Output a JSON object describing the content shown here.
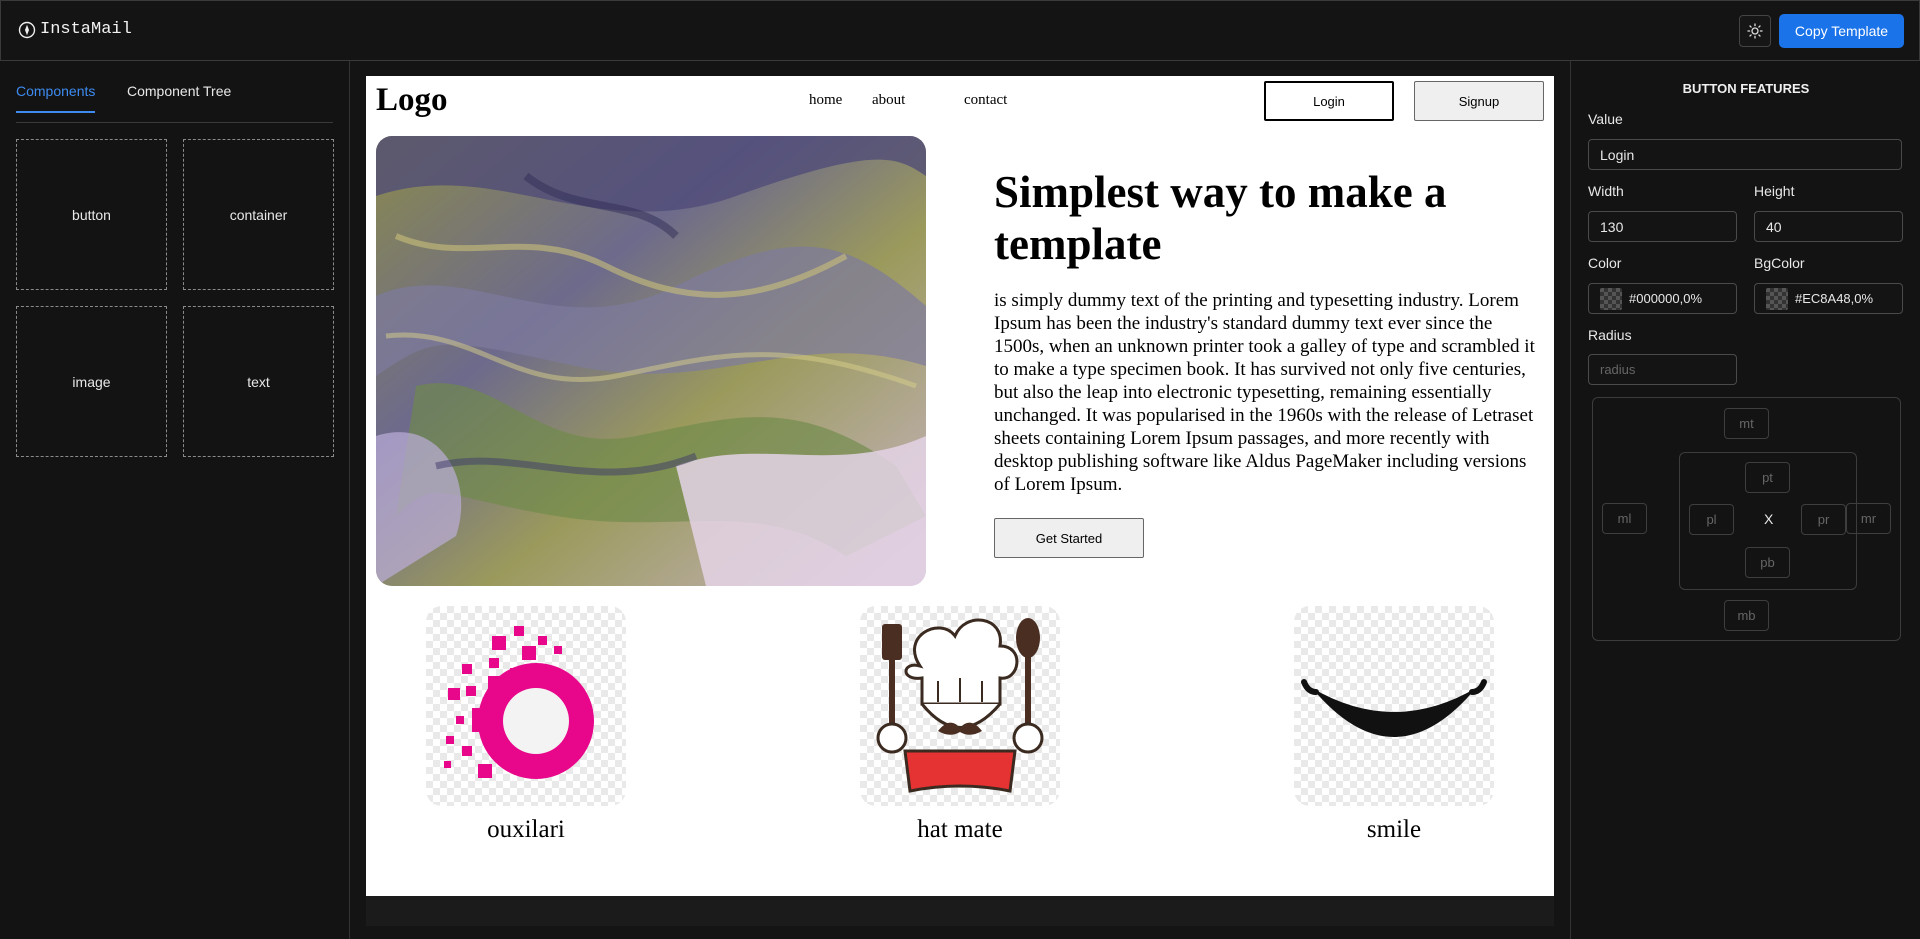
{
  "app": {
    "name": "InstaMail",
    "copy_label": "Copy Template",
    "theme_icon": "sun-icon",
    "brand_icon": "compass-icon"
  },
  "left": {
    "tabs": [
      {
        "label": "Components"
      },
      {
        "label": "Component Tree"
      }
    ],
    "components": [
      {
        "label": "button"
      },
      {
        "label": "container"
      },
      {
        "label": "image"
      },
      {
        "label": "text"
      }
    ]
  },
  "template": {
    "logo": "Logo",
    "nav": [
      {
        "label": "home"
      },
      {
        "label": "about"
      },
      {
        "label": "contact"
      }
    ],
    "login": "Login",
    "signup": "Signup",
    "hero_title": "Simplest way to make a template",
    "hero_body": "is simply dummy text of the printing and typesetting industry. Lorem Ipsum has been the industry's standard dummy text ever since the 1500s, when an unknown printer took a galley of type and scrambled it to make a type specimen book. It has survived not only five centuries, but also the leap into electronic typesetting, remaining essentially unchanged. It was popularised in the 1960s with the release of Letraset sheets containing Lorem Ipsum passages, and more recently with desktop publishing software like Aldus PageMaker including versions of Lorem Ipsum.",
    "cta": "Get Started",
    "cards": [
      {
        "caption": "ouxilari"
      },
      {
        "caption": "hat mate"
      },
      {
        "caption": "smile"
      }
    ]
  },
  "panel": {
    "title": "BUTTON FEATURES",
    "value_label": "Value",
    "value": "Login",
    "width_label": "Width",
    "width": "130",
    "height_label": "Height",
    "height": "40",
    "color_label": "Color",
    "color": "#000000,0%",
    "bgcolor_label": "BgColor",
    "bgcolor": "#EC8A48,0%",
    "radius_label": "Radius",
    "radius_placeholder": "radius",
    "spacing": {
      "mt": "mt",
      "mb": "mb",
      "ml": "ml",
      "mr": "mr",
      "pt": "pt",
      "pb": "pb",
      "pl": "pl",
      "pr": "pr",
      "center": "X"
    }
  },
  "colors": {
    "accent": "#1a73e8",
    "tab_active": "#3d8bf0",
    "ouxilari_pink": "#e8068a",
    "hat_red": "#e53232"
  }
}
